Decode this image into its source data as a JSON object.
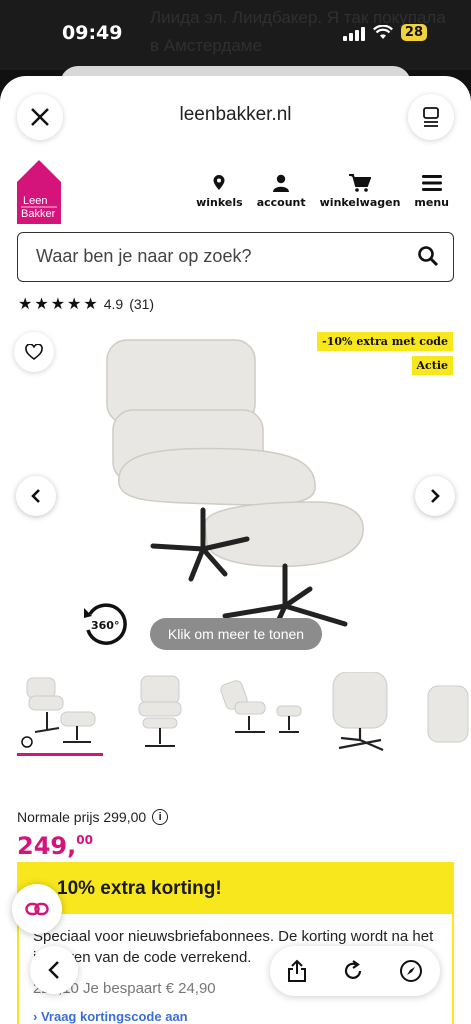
{
  "status": {
    "time": "09:49",
    "battery": "28",
    "background_text": "Лиида эл. Лиидбакер. Я так покупала в Амстердаме"
  },
  "browser": {
    "url": "leenbakker.nl"
  },
  "logo": {
    "line1": "Leen",
    "line2": "Bakker"
  },
  "nav": [
    {
      "label": "winkels",
      "icon": "location-pin-icon"
    },
    {
      "label": "account",
      "icon": "user-icon"
    },
    {
      "label": "winkelwagen",
      "icon": "cart-icon"
    },
    {
      "label": "menu",
      "icon": "hamburger-menu-icon"
    }
  ],
  "search": {
    "placeholder": "Waar ben je naar op zoek?"
  },
  "rating": {
    "score": "4.9",
    "count": "(31)",
    "stars": 5
  },
  "badges": {
    "discount": "-10% extra met code",
    "promo": "Actie"
  },
  "gallery": {
    "rotate_label": "360°",
    "tooltip": "Klik om meer te tonen"
  },
  "pricing": {
    "normal_label": "Normale prijs 299,00",
    "price_main": "249,",
    "price_cents": "00"
  },
  "promo": {
    "headline": "10% extra korting!",
    "body": "Speciaal voor nieuwsbriefabonnees. De korting wordt na het invoeren van de code verrekend.",
    "sub": "224,10   Je bespaart € 24,90",
    "link": "Vraag kortingscode aan"
  },
  "colors": {
    "brand": "#d4147a",
    "accent": "#f8e71c"
  }
}
